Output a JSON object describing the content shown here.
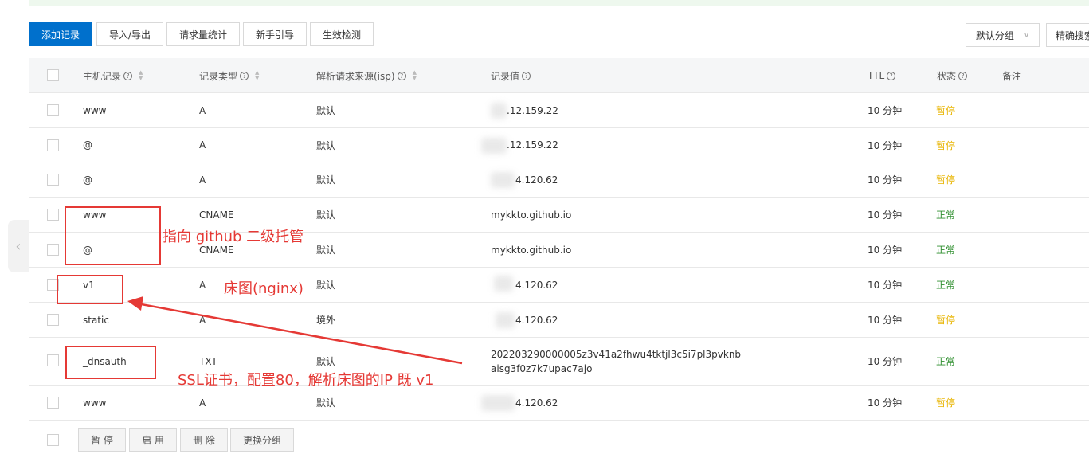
{
  "toolbar": {
    "add": "添加记录",
    "import_export": "导入/导出",
    "stats": "请求量统计",
    "guide": "新手引导",
    "check": "生效检测",
    "group_select": "默认分组",
    "search": "精确搜索"
  },
  "columns": {
    "host": "主机记录",
    "type": "记录类型",
    "isp": "解析请求来源(isp)",
    "value": "记录值",
    "ttl": "TTL",
    "status": "状态",
    "remark": "备注"
  },
  "rows": [
    {
      "host": "www",
      "type": "A",
      "isp": "默认",
      "value": ".12.159.22",
      "ttl": "10 分钟",
      "status": "暂停"
    },
    {
      "host": "@",
      "type": "A",
      "isp": "默认",
      "value": ".12.159.22",
      "ttl": "10 分钟",
      "status": "暂停"
    },
    {
      "host": "@",
      "type": "A",
      "isp": "默认",
      "value": "4.120.62",
      "ttl": "10 分钟",
      "status": "暂停"
    },
    {
      "host": "www",
      "type": "CNAME",
      "isp": "默认",
      "value": "mykkto.github.io",
      "ttl": "10 分钟",
      "status": "正常"
    },
    {
      "host": "@",
      "type": "CNAME",
      "isp": "默认",
      "value": "mykkto.github.io",
      "ttl": "10 分钟",
      "status": "正常"
    },
    {
      "host": "v1",
      "type": "A",
      "isp": "默认",
      "value": "4.120.62",
      "ttl": "10 分钟",
      "status": "正常"
    },
    {
      "host": "static",
      "type": "A",
      "isp": "境外",
      "value": "4.120.62",
      "ttl": "10 分钟",
      "status": "暂停"
    },
    {
      "host": "_dnsauth",
      "type": "TXT",
      "isp": "默认",
      "value_line1": "202203290000005z3v41a2fhwu4tktjl3c5i7pl3pvknb",
      "value_line2": "aisg3f0z7k7upac7ajo",
      "ttl": "10 分钟",
      "status": "正常"
    },
    {
      "host": "www",
      "type": "A",
      "isp": "默认",
      "value": "4.120.62",
      "ttl": "10 分钟",
      "status": "暂停"
    }
  ],
  "bottom": {
    "pause": "暂 停",
    "enable": "启 用",
    "delete": "删 除",
    "change_group": "更换分组"
  },
  "annotations": {
    "github": "指向 github 二级托管",
    "nginx": "床图(nginx)",
    "ssl": "SSL证书，配置80，解析床图的IP 既 v1"
  },
  "colors": {
    "primary": "#0070cc",
    "paused": "#e8b400",
    "normal": "#2f8f2f",
    "annotation": "#e53935"
  }
}
